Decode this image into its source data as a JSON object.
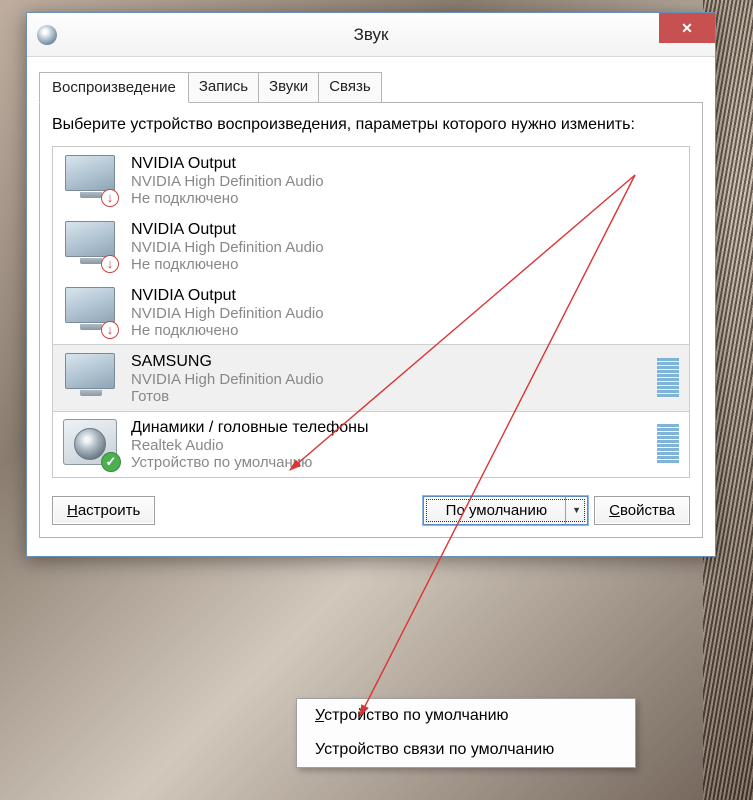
{
  "window": {
    "title": "Звук"
  },
  "tabs": {
    "playback": "Воспроизведение",
    "recording": "Запись",
    "sounds": "Звуки",
    "communications": "Связь"
  },
  "instruction": "Выберите устройство воспроизведения, параметры которого нужно изменить:",
  "devices": [
    {
      "name": "NVIDIA Output",
      "driver": "NVIDIA High Definition Audio",
      "status": "Не подключено",
      "icon": "monitor",
      "overlay": "down",
      "meter": false,
      "selected": false
    },
    {
      "name": "NVIDIA Output",
      "driver": "NVIDIA High Definition Audio",
      "status": "Не подключено",
      "icon": "monitor",
      "overlay": "down",
      "meter": false,
      "selected": false
    },
    {
      "name": "NVIDIA Output",
      "driver": "NVIDIA High Definition Audio",
      "status": "Не подключено",
      "icon": "monitor",
      "overlay": "down",
      "meter": false,
      "selected": false
    },
    {
      "name": "SAMSUNG",
      "driver": "NVIDIA High Definition Audio",
      "status": "Готов",
      "icon": "monitor",
      "overlay": "none",
      "meter": true,
      "selected": true
    },
    {
      "name": "Динамики / головные телефоны",
      "driver": "Realtek Audio",
      "status": "Устройство по умолчанию",
      "icon": "speaker",
      "overlay": "check",
      "meter": true,
      "selected": false
    }
  ],
  "buttons": {
    "configure": "Настроить",
    "set_default": "По умолчанию",
    "properties": "Свойства"
  },
  "dropdown": {
    "default_device": "Устройство по умолчанию",
    "default_comm_device": "Устройство связи по умолчанию"
  }
}
